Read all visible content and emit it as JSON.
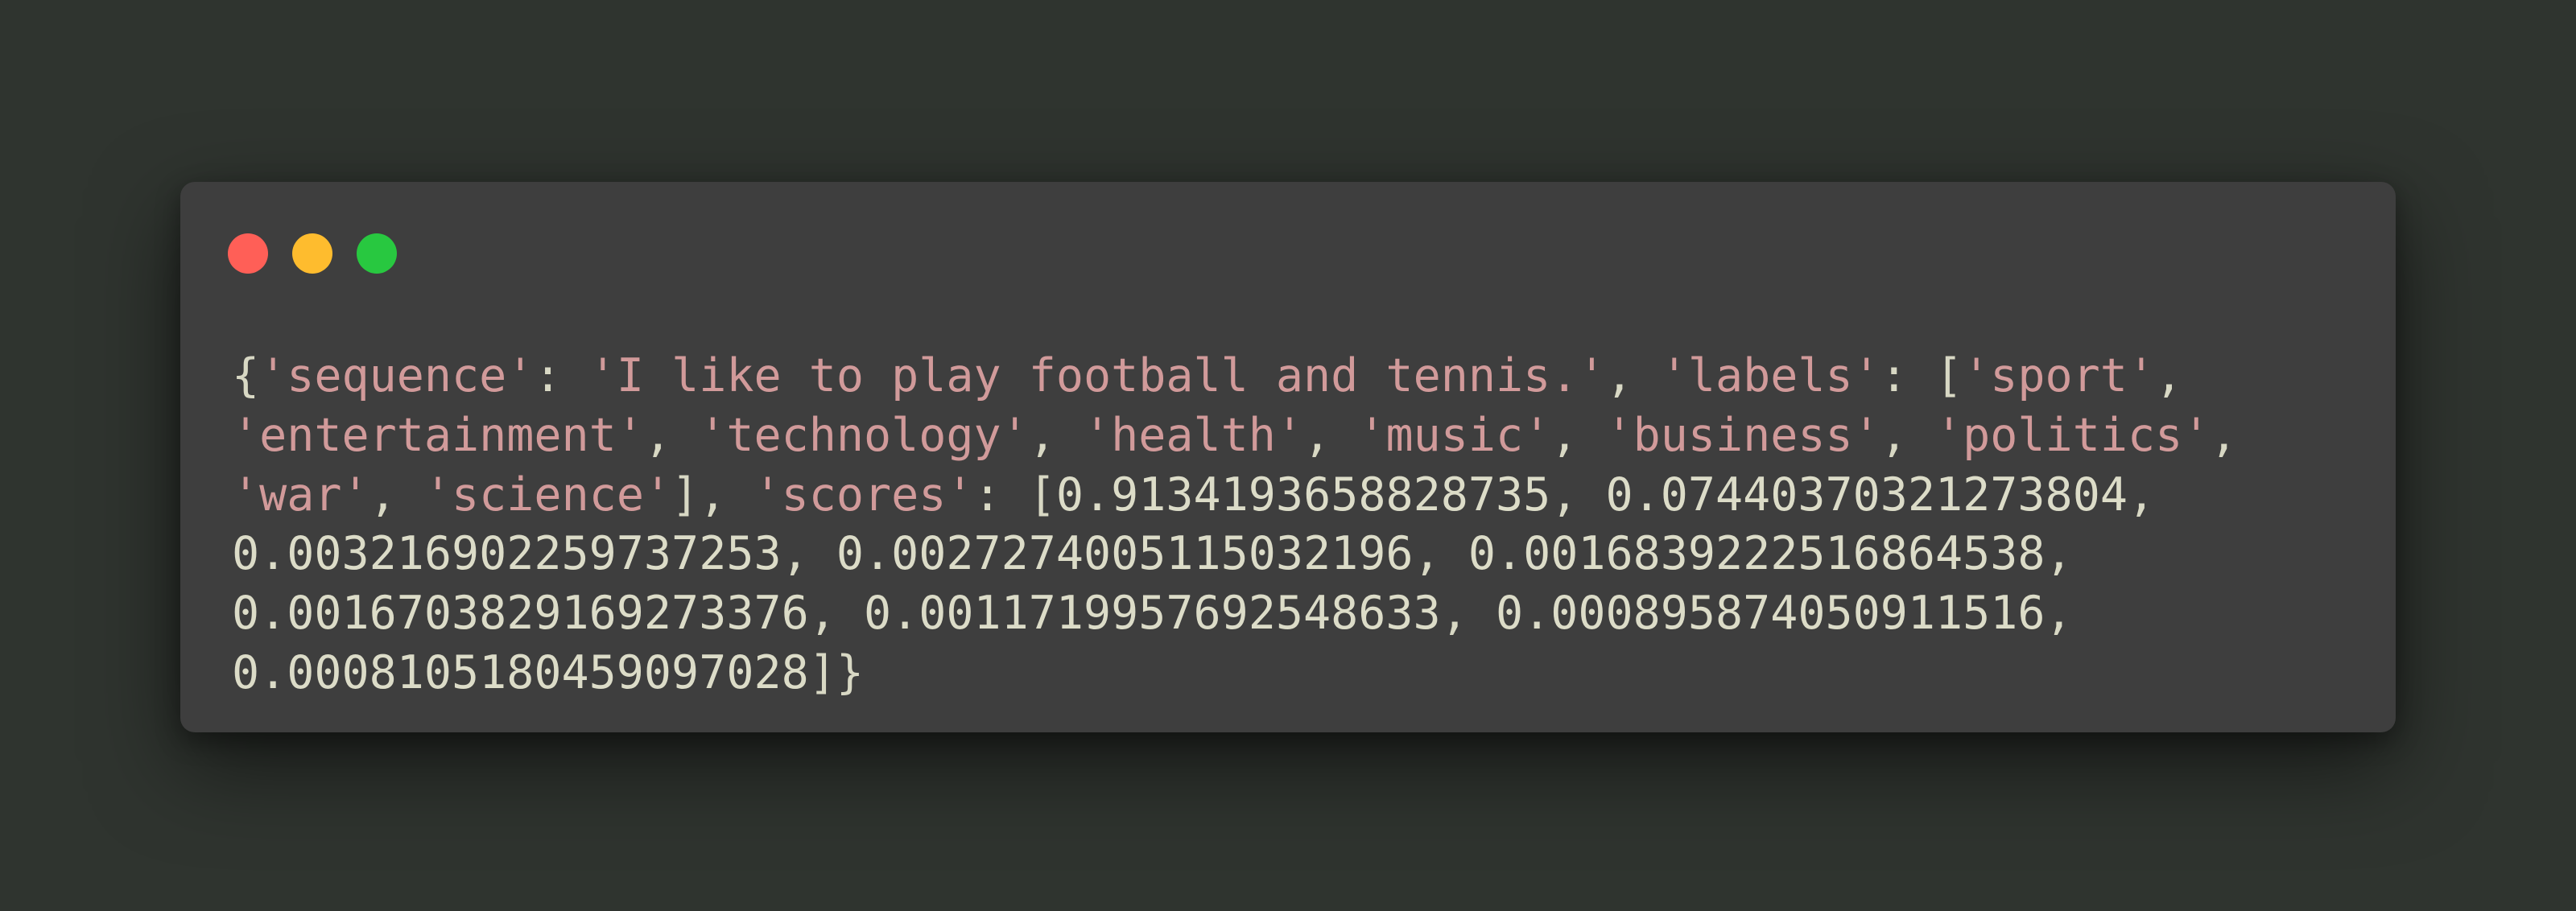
{
  "window": {
    "buttons": {
      "close_color": "#ff5f57",
      "minimize_color": "#febc2e",
      "maximize_color": "#28c840"
    }
  },
  "code": {
    "lines": [
      [
        {
          "t": "p",
          "v": "{"
        },
        {
          "t": "s",
          "v": "'sequence'"
        },
        {
          "t": "p",
          "v": ": "
        },
        {
          "t": "s",
          "v": "'I like to play football and tennis.'"
        },
        {
          "t": "p",
          "v": ", "
        },
        {
          "t": "s",
          "v": "'labels'"
        },
        {
          "t": "p",
          "v": ": ["
        },
        {
          "t": "s",
          "v": "'sport'"
        },
        {
          "t": "p",
          "v": ","
        }
      ],
      [
        {
          "t": "s",
          "v": "'entertainment'"
        },
        {
          "t": "p",
          "v": ", "
        },
        {
          "t": "s",
          "v": "'technology'"
        },
        {
          "t": "p",
          "v": ", "
        },
        {
          "t": "s",
          "v": "'health'"
        },
        {
          "t": "p",
          "v": ", "
        },
        {
          "t": "s",
          "v": "'music'"
        },
        {
          "t": "p",
          "v": ", "
        },
        {
          "t": "s",
          "v": "'business'"
        },
        {
          "t": "p",
          "v": ", "
        },
        {
          "t": "s",
          "v": "'politics'"
        },
        {
          "t": "p",
          "v": ","
        }
      ],
      [
        {
          "t": "s",
          "v": "'war'"
        },
        {
          "t": "p",
          "v": ", "
        },
        {
          "t": "s",
          "v": "'science'"
        },
        {
          "t": "p",
          "v": "], "
        },
        {
          "t": "s",
          "v": "'scores'"
        },
        {
          "t": "p",
          "v": ": ["
        },
        {
          "t": "n",
          "v": "0.9134193658828735"
        },
        {
          "t": "p",
          "v": ", "
        },
        {
          "t": "n",
          "v": "0.07440370321273804"
        },
        {
          "t": "p",
          "v": ","
        }
      ],
      [
        {
          "t": "n",
          "v": "0.003216902259737253"
        },
        {
          "t": "p",
          "v": ", "
        },
        {
          "t": "n",
          "v": "0.0027274005115032196"
        },
        {
          "t": "p",
          "v": ", "
        },
        {
          "t": "n",
          "v": "0.0016839222516864538"
        },
        {
          "t": "p",
          "v": ","
        }
      ],
      [
        {
          "t": "n",
          "v": "0.0016703829169273376"
        },
        {
          "t": "p",
          "v": ", "
        },
        {
          "t": "n",
          "v": "0.0011719957692548633"
        },
        {
          "t": "p",
          "v": ", "
        },
        {
          "t": "n",
          "v": "0.0008958740509115 16"
        },
        {
          "t": "p",
          "v": ","
        }
      ],
      [
        {
          "t": "n",
          "v": "0.0008105180459097028"
        },
        {
          "t": "p",
          "v": "]}"
        }
      ]
    ]
  }
}
